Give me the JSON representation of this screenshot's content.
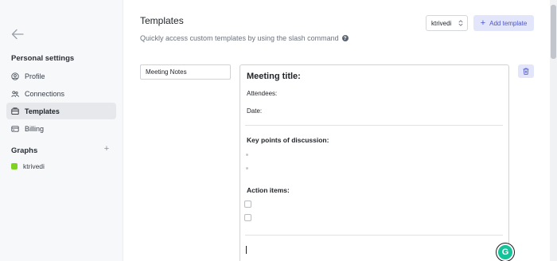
{
  "sidebar": {
    "section_title": "Personal settings",
    "items": [
      {
        "label": "Profile",
        "icon": "user-circle-icon"
      },
      {
        "label": "Connections",
        "icon": "connections-icon"
      },
      {
        "label": "Templates",
        "icon": "template-icon",
        "active": true
      },
      {
        "label": "Billing",
        "icon": "credit-card-icon"
      }
    ],
    "graphs_title": "Graphs",
    "graphs_add_label": "+",
    "graphs": [
      {
        "label": "ktrivedi",
        "color": "#7ed321"
      }
    ]
  },
  "header": {
    "title": "Templates",
    "subtitle": "Quickly access custom templates by using the slash command",
    "info_icon_glyph": "?"
  },
  "toolbar": {
    "graph_select_value": "ktrivedi",
    "add_template_label": "Add template",
    "add_template_plus": "+"
  },
  "template": {
    "name_value": "Meeting Notes",
    "heading": "Meeting title:",
    "attendees_label": "Attendees:",
    "date_label": "Date:",
    "key_points_heading": "Key points of discussion:",
    "action_items_heading": "Action items:"
  },
  "grammarly": {
    "glyph": "G"
  },
  "colors": {
    "accent": "#4a55c9",
    "accent_bg": "#e3e6fb",
    "sidebar_bg": "#f7f8fa",
    "graph_swatch": "#7ed321",
    "grammarly": "#15c39a"
  }
}
